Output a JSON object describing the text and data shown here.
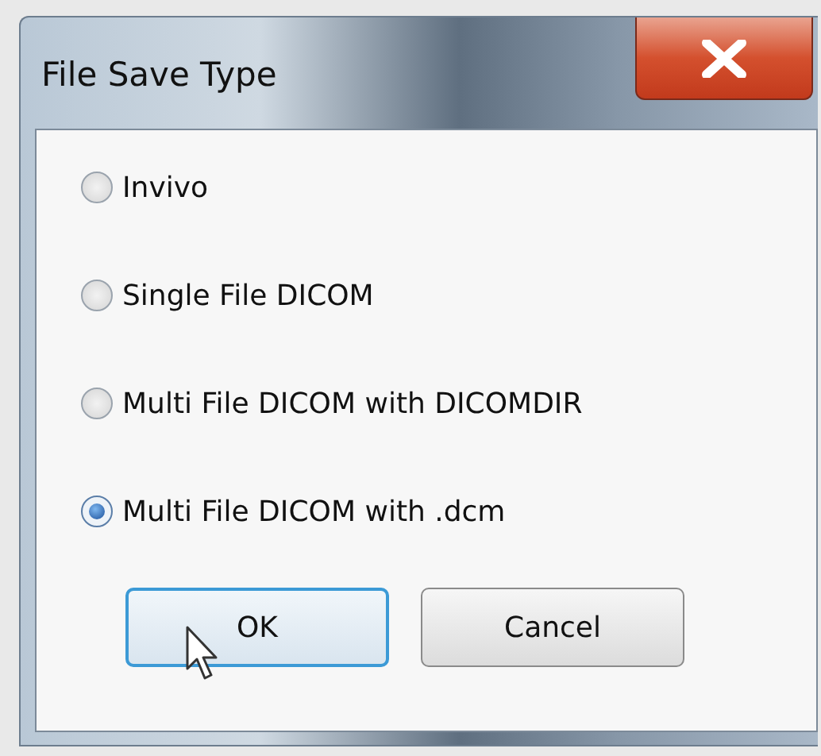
{
  "window": {
    "title": "File Save Type"
  },
  "options": [
    {
      "label": "Invivo",
      "selected": false
    },
    {
      "label": "Single File DICOM",
      "selected": false
    },
    {
      "label": "Multi File DICOM with DICOMDIR",
      "selected": false
    },
    {
      "label": "Multi File DICOM with .dcm",
      "selected": true
    }
  ],
  "buttons": [
    {
      "label": "OK",
      "focused": true
    },
    {
      "label": "Cancel",
      "focused": false
    }
  ]
}
